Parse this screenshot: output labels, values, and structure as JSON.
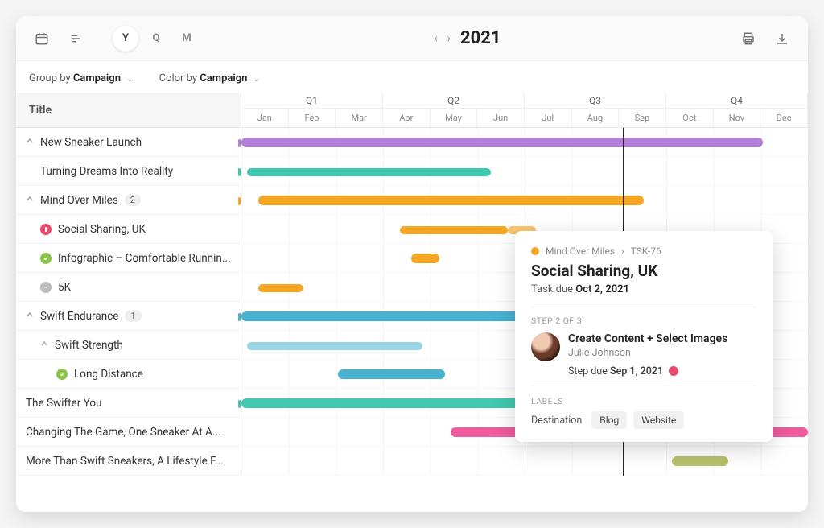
{
  "toolbar": {
    "calendar_icon": "calendar-icon",
    "list_icon": "list-icon",
    "view_year": "Y",
    "view_quarter": "Q",
    "view_month": "M",
    "year": "2021",
    "print_icon": "print-icon",
    "download_icon": "download-icon"
  },
  "controls": {
    "group_prefix": "Group by",
    "group_value": "Campaign",
    "color_prefix": "Color by",
    "color_value": "Campaign"
  },
  "header": {
    "title_col": "Title",
    "quarters": [
      "Q1",
      "Q2",
      "Q3",
      "Q4"
    ],
    "months": [
      "Jan",
      "Feb",
      "Mar",
      "Apr",
      "May",
      "Jun",
      "Jul",
      "Aug",
      "Sep",
      "Oct",
      "Nov",
      "Dec"
    ]
  },
  "colors": {
    "purple": "#b27fd9",
    "teal": "#3ec9b0",
    "orange": "#f5a623",
    "orange_light": "#f9c66f",
    "blue": "#47b1d0",
    "pink": "#ef5b9c",
    "olive": "#b6c06a"
  },
  "rows": [
    {
      "label": "New Sneaker Launch",
      "caret": true,
      "indent": 0,
      "tick": "purple",
      "bars": [
        {
          "color": "purple",
          "start": 0,
          "end": 92,
          "thick": true
        }
      ]
    },
    {
      "label": "Turning Dreams Into Reality",
      "indent": 1,
      "tick": "teal",
      "bars": [
        {
          "color": "teal",
          "start": 1,
          "end": 44
        }
      ]
    },
    {
      "label": "Mind Over Miles",
      "caret": true,
      "indent": 0,
      "badge": "2",
      "tick": "orange",
      "bars": [
        {
          "color": "orange",
          "start": 3,
          "end": 71,
          "thick": true
        }
      ]
    },
    {
      "label": "Social Sharing, UK",
      "indent": 1,
      "status": "red",
      "bars": [
        {
          "color": "orange",
          "start": 28,
          "end": 47
        },
        {
          "color": "orange_light",
          "start": 47,
          "end": 52
        }
      ]
    },
    {
      "label": "Infographic – Comfortable Runnin...",
      "indent": 1,
      "status": "green",
      "bars": [
        {
          "color": "orange",
          "start": 30,
          "end": 35,
          "thick": true
        }
      ]
    },
    {
      "label": "5K",
      "indent": 1,
      "status": "grey",
      "bars": [
        {
          "color": "orange",
          "start": 3,
          "end": 11
        }
      ]
    },
    {
      "label": "Swift Endurance",
      "caret": true,
      "indent": 0,
      "badge": "1",
      "tick": "blue",
      "bars": [
        {
          "color": "blue",
          "start": 0,
          "end": 70,
          "thick": true
        }
      ]
    },
    {
      "label": "Swift Strength",
      "caret": true,
      "indent": 1,
      "bars": [
        {
          "color": "blue",
          "start": 1,
          "end": 32,
          "light": true
        }
      ]
    },
    {
      "label": "Long Distance",
      "indent": 2,
      "status": "green",
      "bars": [
        {
          "color": "blue",
          "start": 17,
          "end": 36,
          "thick": true
        }
      ]
    },
    {
      "label": "The Swifter You",
      "indent": 0,
      "tick": "teal",
      "bars": [
        {
          "color": "teal",
          "start": 0,
          "end": 70,
          "thick": true
        }
      ]
    },
    {
      "label": "Changing The Game, One Sneaker At A...",
      "indent": 0,
      "bars": [
        {
          "color": "pink",
          "start": 37,
          "end": 100,
          "thick": true
        }
      ]
    },
    {
      "label": "More Than Swift Sneakers, A Lifestyle F...",
      "indent": 0,
      "bars": [
        {
          "color": "olive",
          "start": 76,
          "end": 86,
          "thick": true
        }
      ]
    }
  ],
  "card": {
    "breadcrumb_parent": "Mind Over Miles",
    "breadcrumb_sep": "›",
    "breadcrumb_id": "TSK-76",
    "title": "Social Sharing, UK",
    "task_due_prefix": "Task due",
    "task_due": "Oct 2, 2021",
    "step_count": "STEP 2 OF 3",
    "step_title": "Create Content + Select Images",
    "assignee": "Julie Johnson",
    "step_due_prefix": "Step due",
    "step_due": "Sep 1, 2021",
    "labels_heading": "LABELS",
    "label_free": "Destination",
    "tags": [
      "Blog",
      "Website"
    ]
  }
}
